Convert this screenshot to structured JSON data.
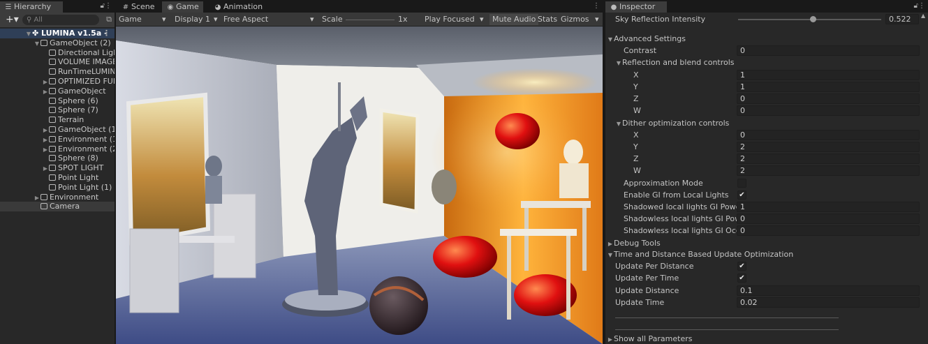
{
  "hierarchy": {
    "tab_label": "Hierarchy",
    "search_placeholder": "All",
    "add_label": "+▾",
    "rows": [
      {
        "label": "LUMINA v1.5a -",
        "indent": 0,
        "arrow": "▼",
        "kind": "scene"
      },
      {
        "label": "GameObject (2)",
        "indent": 1,
        "arrow": "▼",
        "kind": "obj"
      },
      {
        "label": "Directional Ligh",
        "indent": 2,
        "arrow": "",
        "kind": "obj"
      },
      {
        "label": "VOLUME IMAGE",
        "indent": 2,
        "arrow": "",
        "kind": "obj"
      },
      {
        "label": "RunTimeLUMIN",
        "indent": 2,
        "arrow": "",
        "kind": "obj"
      },
      {
        "label": "OPTIMIZED FUL",
        "indent": 2,
        "arrow": "▶",
        "kind": "obj"
      },
      {
        "label": "GameObject",
        "indent": 2,
        "arrow": "▶",
        "kind": "obj"
      },
      {
        "label": "Sphere (6)",
        "indent": 2,
        "arrow": "",
        "kind": "obj"
      },
      {
        "label": "Sphere (7)",
        "indent": 2,
        "arrow": "",
        "kind": "obj"
      },
      {
        "label": "Terrain",
        "indent": 2,
        "arrow": "",
        "kind": "obj"
      },
      {
        "label": "GameObject (1)",
        "indent": 2,
        "arrow": "▶",
        "kind": "obj"
      },
      {
        "label": "Environment (1)",
        "indent": 2,
        "arrow": "▶",
        "kind": "obj"
      },
      {
        "label": "Environment (2)",
        "indent": 2,
        "arrow": "▶",
        "kind": "obj"
      },
      {
        "label": "Sphere (8)",
        "indent": 2,
        "arrow": "",
        "kind": "obj"
      },
      {
        "label": "SPOT LIGHT",
        "indent": 2,
        "arrow": "▶",
        "kind": "obj"
      },
      {
        "label": "Point Light",
        "indent": 2,
        "arrow": "",
        "kind": "obj"
      },
      {
        "label": "Point Light (1)",
        "indent": 2,
        "arrow": "",
        "kind": "obj"
      },
      {
        "label": "Environment",
        "indent": 1,
        "arrow": "▶",
        "kind": "obj"
      },
      {
        "label": "Camera",
        "indent": 1,
        "arrow": "",
        "kind": "obj",
        "selected": true
      }
    ]
  },
  "tabs": {
    "scene": "Scene",
    "game": "Game",
    "animation": "Animation",
    "inspector": "Inspector"
  },
  "game_toolbar": {
    "view": "Game",
    "display": "Display 1",
    "aspect": "Free Aspect",
    "scale_label": "Scale",
    "scale_value": "1x",
    "play_mode": "Play Focused",
    "mute": "Mute Audio",
    "stats": "Stats",
    "gizmos": "Gizmos"
  },
  "inspector": {
    "sky_reflection": {
      "label": "Sky Reflection Intensity",
      "value": "0.522",
      "fraction": 0.522
    },
    "advanced_settings": "Advanced Settings",
    "contrast": {
      "label": "Contrast",
      "value": "0"
    },
    "reflection_blend": {
      "label": "Reflection and blend controls",
      "x": {
        "label": "X",
        "value": "1"
      },
      "y": {
        "label": "Y",
        "value": "1"
      },
      "z": {
        "label": "Z",
        "value": "0"
      },
      "w": {
        "label": "W",
        "value": "0"
      }
    },
    "dither": {
      "label": "Dither optimization controls",
      "x": {
        "label": "X",
        "value": "0"
      },
      "y": {
        "label": "Y",
        "value": "2"
      },
      "z": {
        "label": "Z",
        "value": "2"
      },
      "w": {
        "label": "W",
        "value": "2"
      }
    },
    "approximation_mode": {
      "label": "Approximation Mode",
      "checked": false
    },
    "enable_gi": {
      "label": "Enable GI from Local Lights",
      "checked": true
    },
    "shadowed_gi_power": {
      "label": "Shadowed local lights GI Power",
      "value": "1"
    },
    "shadowless_gi_power": {
      "label": "Shadowless local lights GI Powe",
      "value": "0"
    },
    "shadowless_gi_occlu": {
      "label": "Shadowless local lights GI Occlu",
      "value": "0"
    },
    "debug_tools": "Debug Tools",
    "time_distance": "Time and Distance Based Update Optimization",
    "update_per_distance": {
      "label": "Update Per Distance",
      "checked": true
    },
    "update_per_time": {
      "label": "Update Per Time",
      "checked": true
    },
    "update_distance": {
      "label": "Update Distance",
      "value": "0.1"
    },
    "update_time": {
      "label": "Update Time",
      "value": "0.02"
    },
    "show_all": "Show all Parameters"
  },
  "colors": {
    "panel": "#282828",
    "toolbar": "#383838",
    "selection": "#2f3f57",
    "accent_warm": "#f0a030"
  }
}
